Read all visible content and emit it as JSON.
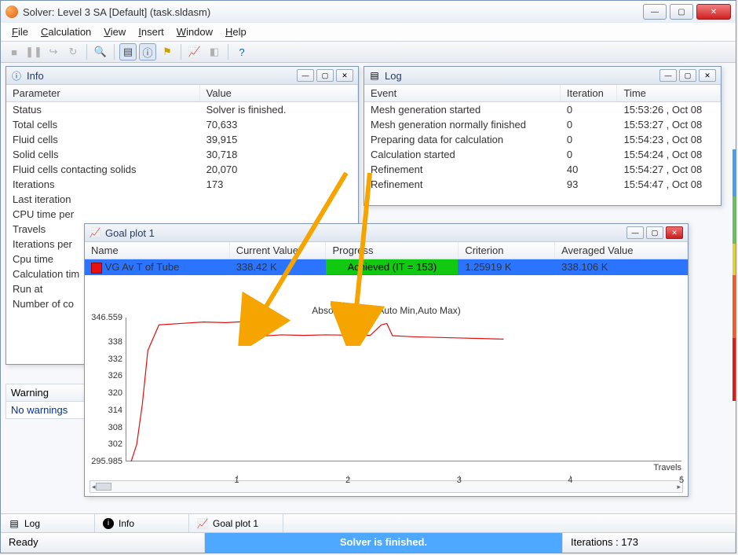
{
  "app": {
    "title": "Solver: Level 3 SA [Default] (task.sldasm)"
  },
  "menu": {
    "file": "File",
    "calculation": "Calculation",
    "view": "View",
    "insert": "Insert",
    "window": "Window",
    "help": "Help"
  },
  "mdi": {
    "info": {
      "title": "Info",
      "headers": {
        "param": "Parameter",
        "value": "Value"
      },
      "rows": [
        {
          "k": "Status",
          "v": "Solver is finished."
        },
        {
          "k": "Total cells",
          "v": "70,633"
        },
        {
          "k": "Fluid cells",
          "v": "39,915"
        },
        {
          "k": "Solid cells",
          "v": "30,718"
        },
        {
          "k": "Fluid cells contacting solids",
          "v": "20,070"
        },
        {
          "k": "Iterations",
          "v": "173"
        },
        {
          "k": "Last iteration",
          "v": ""
        },
        {
          "k": "CPU time per",
          "v": ""
        },
        {
          "k": "Travels",
          "v": ""
        },
        {
          "k": "Iterations per",
          "v": ""
        },
        {
          "k": "Cpu time",
          "v": ""
        },
        {
          "k": "Calculation tim",
          "v": ""
        },
        {
          "k": "Run at",
          "v": ""
        },
        {
          "k": "Number of co",
          "v": ""
        }
      ]
    },
    "log": {
      "title": "Log",
      "headers": {
        "event": "Event",
        "iter": "Iteration",
        "time": "Time"
      },
      "rows": [
        {
          "event": "Mesh generation started",
          "iter": "0",
          "time": "15:53:26 , Oct 08"
        },
        {
          "event": "Mesh generation normally finished",
          "iter": "0",
          "time": "15:53:27 , Oct 08"
        },
        {
          "event": "Preparing data for calculation",
          "iter": "0",
          "time": "15:54:23 , Oct 08"
        },
        {
          "event": "Calculation started",
          "iter": "0",
          "time": "15:54:24 , Oct 08"
        },
        {
          "event": "Refinement",
          "iter": "40",
          "time": "15:54:27 , Oct 08"
        },
        {
          "event": "Refinement",
          "iter": "93",
          "time": "15:54:47 , Oct 08"
        }
      ]
    },
    "warnings": {
      "header": "Warning",
      "text": "No warnings"
    },
    "goal": {
      "title": "Goal plot 1",
      "headers": {
        "name": "Name",
        "current": "Current Value",
        "progress": "Progress",
        "criterion": "Criterion",
        "avg": "Averaged Value"
      },
      "row": {
        "name": "VG Av T of Tube",
        "current": "338.42 K",
        "progress": "Achieved (IT = 153)",
        "criterion": "1.25919 K",
        "avg": "338.106 K"
      },
      "chart_title": "Absolute Scale(Auto Min,Auto Max)",
      "chart_xlabel": "Travels"
    }
  },
  "taskbar": {
    "log": "Log",
    "info": "Info",
    "goal": "Goal plot 1"
  },
  "status": {
    "ready": "Ready",
    "center": "Solver is finished.",
    "iterations": "Iterations : 173"
  },
  "chart_data": {
    "type": "line",
    "title": "Absolute Scale(Auto Min,Auto Max)",
    "xlabel": "Travels",
    "ylabel": "",
    "xlim": [
      0,
      5
    ],
    "ylim": [
      295.985,
      346.559
    ],
    "y_ticks": [
      346.559,
      338,
      332,
      326,
      320,
      314,
      308,
      302,
      295.985
    ],
    "x_ticks": [
      1,
      2,
      3,
      4,
      5
    ],
    "series": [
      {
        "name": "VG Av T of Tube",
        "color": "#e01010",
        "x": [
          0.05,
          0.1,
          0.15,
          0.2,
          0.3,
          0.5,
          0.7,
          0.9,
          1.1,
          1.2,
          1.4,
          1.6,
          1.8,
          2.0,
          2.2,
          2.3,
          2.35,
          2.4,
          2.6,
          2.8,
          3.0,
          3.2,
          3.4
        ],
        "y": [
          296.0,
          302.0,
          316.0,
          335.0,
          344.0,
          344.5,
          345.0,
          344.8,
          345.2,
          340.0,
          340.5,
          340.3,
          340.5,
          340.4,
          340.3,
          344.0,
          344.5,
          340.2,
          339.8,
          339.6,
          339.4,
          339.2,
          339.0
        ]
      }
    ]
  }
}
